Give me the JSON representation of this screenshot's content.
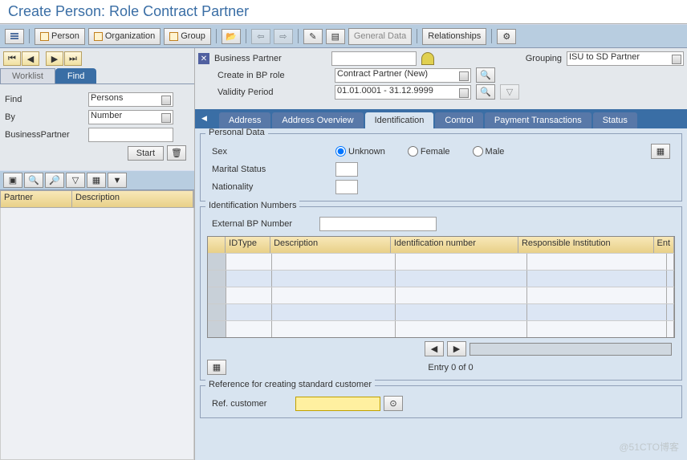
{
  "title": "Create Person: Role Contract Partner",
  "toolbar": {
    "person": "Person",
    "organization": "Organization",
    "group": "Group",
    "general_data": "General Data",
    "relationships": "Relationships"
  },
  "left": {
    "tabs": {
      "worklist": "Worklist",
      "find": "Find"
    },
    "find_label": "Find",
    "find_value": "Persons",
    "by_label": "By",
    "by_value": "Number",
    "bp_label": "BusinessPartner",
    "start": "Start",
    "grid_cols": {
      "partner": "Partner",
      "description": "Description"
    }
  },
  "header": {
    "bp_label": "Business Partner",
    "grouping_label": "Grouping",
    "grouping_value": "ISU  to SD Partner",
    "role_label": "Create in BP role",
    "role_value": "Contract Partner (New)",
    "validity_label": "Validity Period",
    "validity_value": "01.01.0001 - 31.12.9999"
  },
  "main_tabs": [
    "Address",
    "Address Overview",
    "Identification",
    "Control",
    "Payment Transactions",
    "Status"
  ],
  "personal": {
    "legend": "Personal Data",
    "sex_label": "Sex",
    "sex_options": {
      "unknown": "Unknown",
      "female": "Female",
      "male": "Male"
    },
    "marital_label": "Marital Status",
    "nationality_label": "Nationality"
  },
  "idnum": {
    "legend": "Identification Numbers",
    "ext_label": "External BP Number",
    "cols": {
      "idtype": "IDType",
      "desc": "Description",
      "idnum": "Identification number",
      "resp": "Responsible Institution",
      "ent": "Ent"
    },
    "entry": "Entry 0 of 0"
  },
  "ref": {
    "legend": "Reference for creating standard customer",
    "label": "Ref. customer"
  },
  "watermark": "@51CTO博客"
}
